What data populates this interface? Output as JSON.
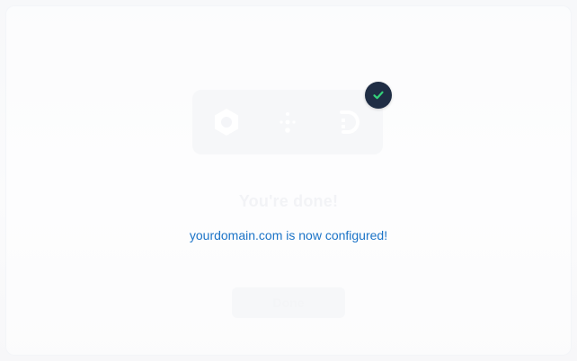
{
  "confirmation": {
    "title": "You're done!",
    "message": "yourdomain.com is now configured!",
    "done_label": "Done"
  },
  "icons": {
    "left": "gear-hexagon-icon",
    "middle": "connector-dots-icon",
    "right": "dns-d-logo-icon",
    "badge": "check-icon"
  },
  "colors": {
    "badge_background": "#1f2d44",
    "badge_check": "#34d17a",
    "message_text": "#1a73c7"
  }
}
